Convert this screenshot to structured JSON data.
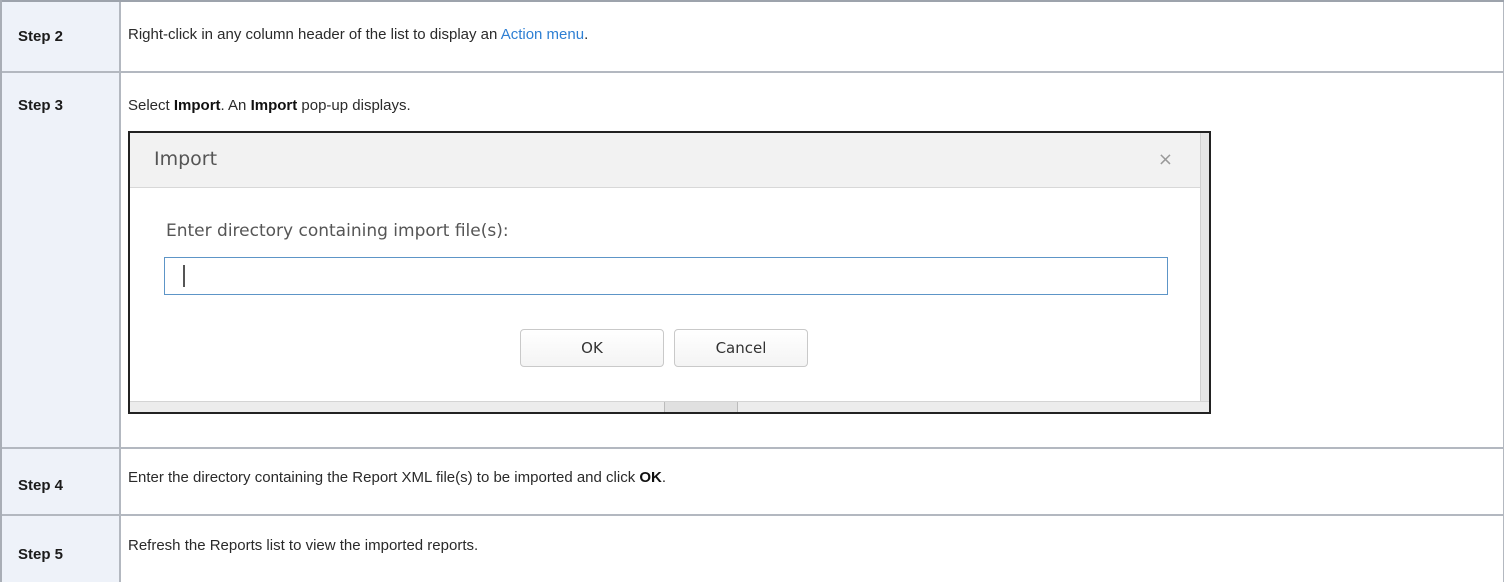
{
  "steps": [
    {
      "label": "Step 2",
      "parts": [
        {
          "t": "Right-click in any column header of the list to display an "
        },
        {
          "link": "Action menu"
        },
        {
          "t": "."
        }
      ]
    },
    {
      "label": "Step 3",
      "parts": [
        {
          "t": "Select "
        },
        {
          "b": "Import"
        },
        {
          "t": ". An "
        },
        {
          "b": "Import"
        },
        {
          "t": " pop-up displays."
        }
      ]
    },
    {
      "label": "Step 4",
      "parts": [
        {
          "t": "Enter the directory containing the Report XML file(s) to be imported and click "
        },
        {
          "b": "OK"
        },
        {
          "t": "."
        }
      ]
    },
    {
      "label": "Step 5",
      "parts": [
        {
          "t": "Refresh the Reports list to view the imported reports."
        }
      ]
    }
  ],
  "dialog": {
    "title": "Import",
    "close_glyph": "×",
    "prompt": "Enter directory containing import file(s):",
    "input_value": "",
    "ok_label": "OK",
    "cancel_label": "Cancel"
  },
  "colors": {
    "link": "#2e7fd3",
    "step_cell_bg": "#eef2f9",
    "input_border": "#5d95c7"
  },
  "icons": {
    "close": "close-icon"
  }
}
